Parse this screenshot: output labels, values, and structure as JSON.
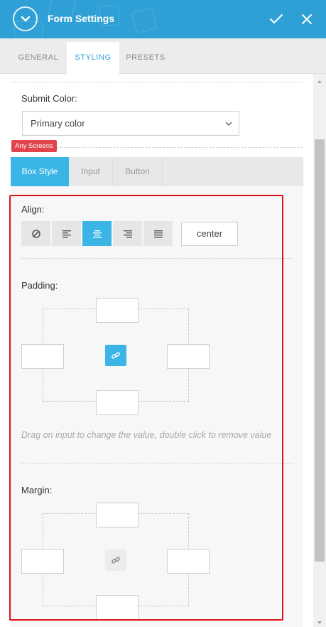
{
  "header": {
    "title": "Form Settings",
    "collapse_icon": "chevron-down-circle-icon",
    "confirm_icon": "check-icon",
    "close_icon": "close-icon",
    "background_color": "#2fa0d6"
  },
  "tabs": [
    {
      "label": "GENERAL",
      "active": false
    },
    {
      "label": "STYLING",
      "active": true
    },
    {
      "label": "PRESETS",
      "active": false
    }
  ],
  "submit_color": {
    "label": "Submit Color:",
    "selected": "Primary color"
  },
  "screen_badge": "Any Screens",
  "subtabs": [
    {
      "label": "Box Style",
      "active": true
    },
    {
      "label": "Input",
      "active": false
    },
    {
      "label": "Button",
      "active": false
    }
  ],
  "align": {
    "label": "Align:",
    "options": [
      "none-icon",
      "align-left-icon",
      "align-center-icon",
      "align-right-icon",
      "align-justify-icon"
    ],
    "selected": "align-center-icon",
    "value": "center"
  },
  "padding": {
    "label": "Padding:",
    "top": "",
    "right": "",
    "bottom": "",
    "left": "",
    "linked": true
  },
  "hint": "Drag on input to change the value, double click to remove value",
  "margin": {
    "label": "Margin:",
    "top": "",
    "right": "",
    "bottom": "",
    "left": "",
    "linked": false
  },
  "colors": {
    "accent": "#3bb5e5",
    "highlight_border": "#d9141b",
    "badge": "#e0454b"
  }
}
